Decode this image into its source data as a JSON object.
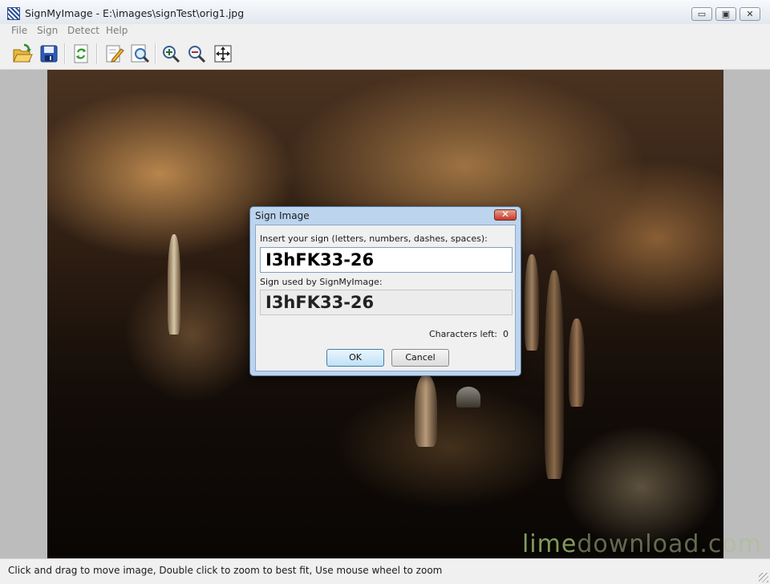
{
  "window": {
    "title": "SignMyImage - E:\\images\\signTest\\orig1.jpg",
    "app_icon": "app-logo-icon",
    "minimize_glyph": "▭",
    "maximize_glyph": "▣",
    "close_glyph": "✕"
  },
  "menubar": {
    "items": [
      "File",
      "Sign",
      "Detect",
      "Help"
    ]
  },
  "toolbar": {
    "buttons": [
      {
        "icon": "open-folder-icon"
      },
      {
        "icon": "save-disk-icon"
      },
      {
        "icon": "refresh-icon"
      },
      {
        "icon": "edit-sign-icon"
      },
      {
        "icon": "detect-sign-icon"
      },
      {
        "icon": "zoom-in-icon"
      },
      {
        "icon": "zoom-out-icon"
      },
      {
        "icon": "fit-to-window-icon"
      }
    ]
  },
  "dialog": {
    "title": "Sign Image",
    "close_glyph": "✕",
    "insert_label": "Insert your sign (letters, numbers, dashes, spaces):",
    "sign_value": "I3hFK33-26",
    "used_label": "Sign used by SignMyImage:",
    "used_value": "I3hFK33-26",
    "chars_left_label": "Characters left:",
    "chars_left_value": "0",
    "ok_label": "OK",
    "cancel_label": "Cancel"
  },
  "statusbar": {
    "text": "Click and drag to move image, Double click to zoom to best fit, Use mouse wheel to zoom"
  },
  "watermark": {
    "part1": "lime",
    "part2": "download.com"
  },
  "colors": {
    "dialog_frame": "#bcd4ee",
    "ok_border": "#3c7fb1",
    "close_red": "#c4392a"
  }
}
